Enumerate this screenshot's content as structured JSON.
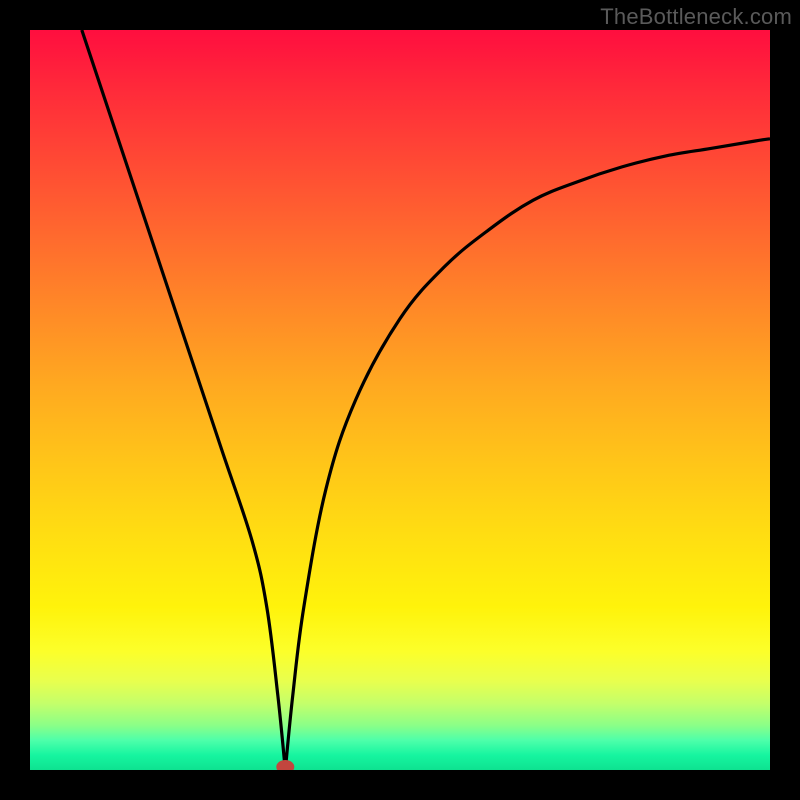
{
  "watermark": "TheBottleneck.com",
  "chart_data": {
    "type": "line",
    "title": "",
    "xlabel": "",
    "ylabel": "",
    "xlim": [
      0,
      100
    ],
    "ylim": [
      0,
      100
    ],
    "grid": false,
    "legend": false,
    "marker": {
      "x": 34.5,
      "y": 0
    },
    "series": [
      {
        "name": "curve",
        "x": [
          7,
          10,
          14,
          18,
          22,
          26,
          30,
          32,
          33.5,
          34.5,
          35.5,
          37,
          40,
          44,
          50,
          56,
          62,
          68,
          74,
          80,
          86,
          92,
          98,
          100
        ],
        "y": [
          100,
          91,
          79,
          67,
          55,
          43,
          31,
          22,
          10,
          0,
          10,
          22,
          38,
          50,
          61,
          68,
          73,
          77,
          79.5,
          81.5,
          83,
          84,
          85,
          85.3
        ]
      }
    ]
  }
}
